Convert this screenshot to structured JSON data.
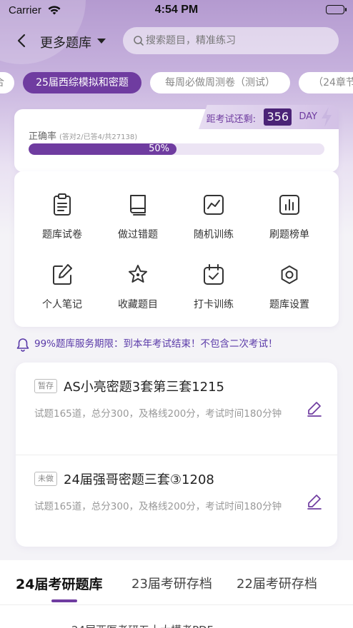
{
  "status_bar": {
    "carrier": "Carrier",
    "time": "4:54 PM"
  },
  "nav": {
    "title": "更多题库",
    "search_placeholder": "搜索题目，精准练习"
  },
  "tabs": [
    {
      "label": "合",
      "active": false
    },
    {
      "label": "25届西综模拟和密题",
      "active": true
    },
    {
      "label": "每周必做周测卷（测试）",
      "active": false
    },
    {
      "label": "（24章节",
      "active": false
    }
  ],
  "accuracy": {
    "countdown_label": "距考试还剩:",
    "countdown_days": "356",
    "countdown_unit": "DAY",
    "label": "正确率",
    "sub": "(答对2/已答4/共27138)",
    "percent_text": "50%",
    "percent": 0.5
  },
  "features": [
    {
      "label": "题库试卷",
      "icon": "clipboard-icon"
    },
    {
      "label": "做过错题",
      "icon": "book-icon"
    },
    {
      "label": "随机训练",
      "icon": "trend-chart-icon"
    },
    {
      "label": "刷题榜单",
      "icon": "bar-chart-icon"
    },
    {
      "label": "个人笔记",
      "icon": "note-edit-icon"
    },
    {
      "label": "收藏题目",
      "icon": "star-icon"
    },
    {
      "label": "打卡训练",
      "icon": "calendar-check-icon"
    },
    {
      "label": "题库设置",
      "icon": "gear-icon"
    }
  ],
  "notice": "99%题库服务期限：到本年考试结束！不包含二次考试！",
  "papers": [
    {
      "badge": "暂存",
      "title": "AS小亮密题3套第三套1215",
      "desc": "试题165道，总分300，及格线200分，考试时间180分钟"
    },
    {
      "badge": "未做",
      "title": "24届强哥密题三套③1208",
      "desc": "试题165道，总分300，及格线200分，考试时间180分钟"
    }
  ],
  "bottom_tabs": [
    {
      "label": "24届考研题库",
      "active": true
    },
    {
      "label": "23届考研存档",
      "active": false
    },
    {
      "label": "22届考研存档",
      "active": false
    }
  ],
  "next_item_partial": "24届西医考研五十大模考PDF",
  "colors": {
    "accent": "#6f3ca0",
    "notice": "#5a3aa8",
    "countdown_bg": "#4b2377"
  }
}
